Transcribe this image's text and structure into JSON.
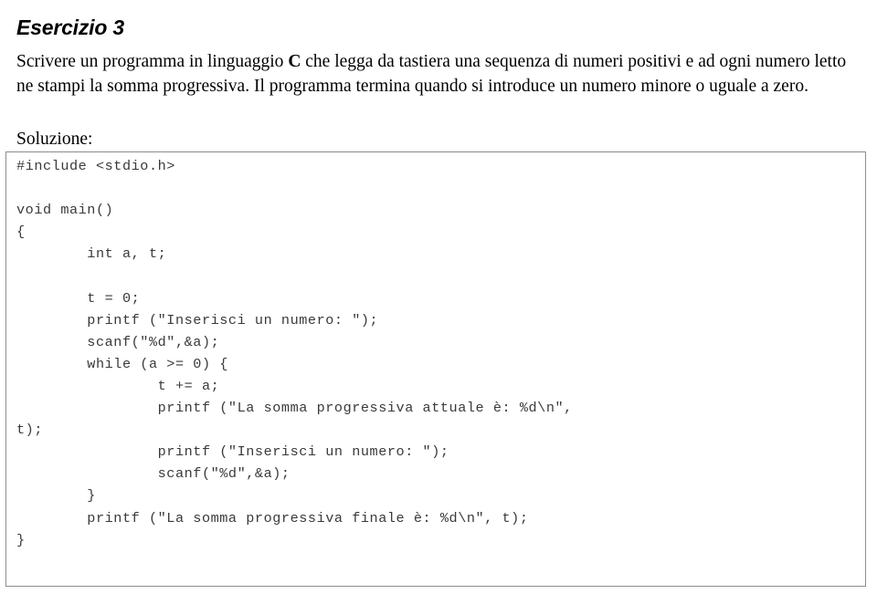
{
  "title": "Esercizio 3",
  "statement": {
    "before_c": "Scrivere un programma in linguaggio ",
    "c_keyword": "C",
    "after_c": " che legga da tastiera una sequenza di numeri positivi e ad ogni numero letto ne stampi la somma progressiva. Il programma termina quando si introduce un numero minore o uguale a zero."
  },
  "solution_label": "Soluzione:",
  "code": {
    "language": "C",
    "border_color": "#8c8c8c",
    "text_color": "#3a3a3a",
    "lines": [
      "#include <stdio.h>",
      "",
      "void main()",
      "{",
      "        int a, t;",
      "",
      "        t = 0;",
      "        printf (\"Inserisci un numero: \");",
      "        scanf(\"%d\",&a);",
      "        while (a >= 0) {",
      "                t += a;",
      "                printf (\"La somma progressiva attuale è: %d\\n\",",
      "t);",
      "                printf (\"Inserisci un numero: \");",
      "                scanf(\"%d\",&a);",
      "        }",
      "        printf (\"La somma progressiva finale è: %d\\n\", t);",
      "}"
    ]
  }
}
